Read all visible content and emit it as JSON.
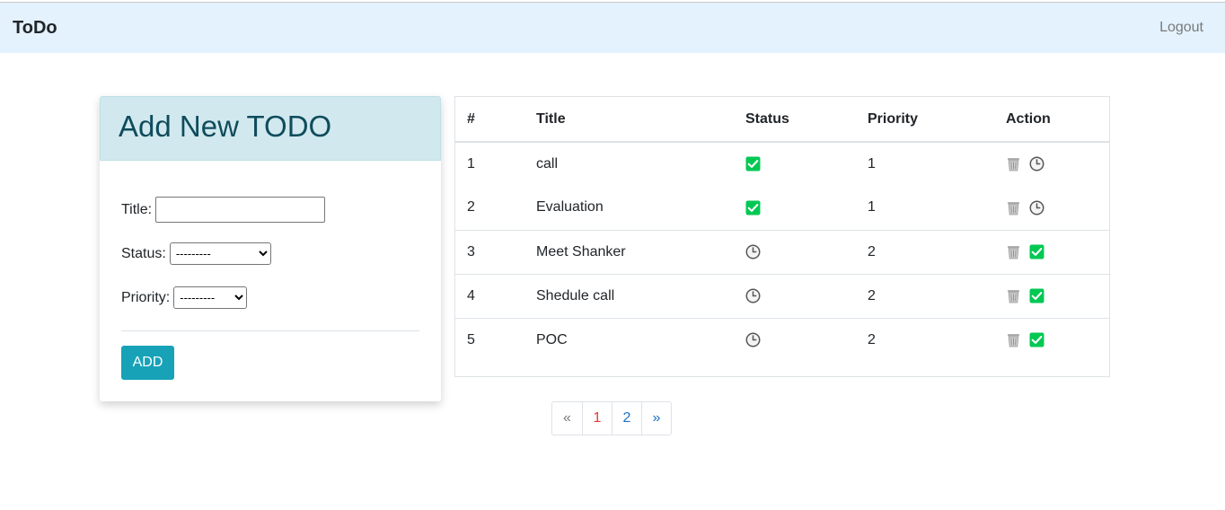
{
  "navbar": {
    "brand": "ToDo",
    "logout": "Logout"
  },
  "form": {
    "title": "Add New TODO",
    "title_label": "Title:",
    "title_value": "",
    "status_label": "Status:",
    "status_selected": "---------",
    "priority_label": "Priority:",
    "priority_selected": "---------",
    "add_label": "ADD"
  },
  "table": {
    "headers": [
      "#",
      "Title",
      "Status",
      "Priority",
      "Action"
    ],
    "rows": [
      {
        "num": "1",
        "title": "call",
        "status": "done",
        "priority": "1",
        "action_icon": "clock-icon"
      },
      {
        "num": "2",
        "title": "Evaluation",
        "status": "done",
        "priority": "1",
        "action_icon": "clock-icon"
      },
      {
        "num": "3",
        "title": "Meet Shanker",
        "status": "pending",
        "priority": "2",
        "action_icon": "check-icon"
      },
      {
        "num": "4",
        "title": "Shedule call",
        "status": "pending",
        "priority": "2",
        "action_icon": "check-icon"
      },
      {
        "num": "5",
        "title": "POC",
        "status": "pending",
        "priority": "2",
        "action_icon": "check-icon"
      }
    ]
  },
  "pagination": {
    "prev": "«",
    "pages": [
      "1",
      "2"
    ],
    "next": "»",
    "active_page": "1"
  },
  "colors": {
    "navbar_bg": "#e3f2fd",
    "header_bg": "#d1e9ee",
    "button": "#17a2b8",
    "check": "#00c853",
    "active_page": "#e53935",
    "link": "#1a73c5"
  }
}
